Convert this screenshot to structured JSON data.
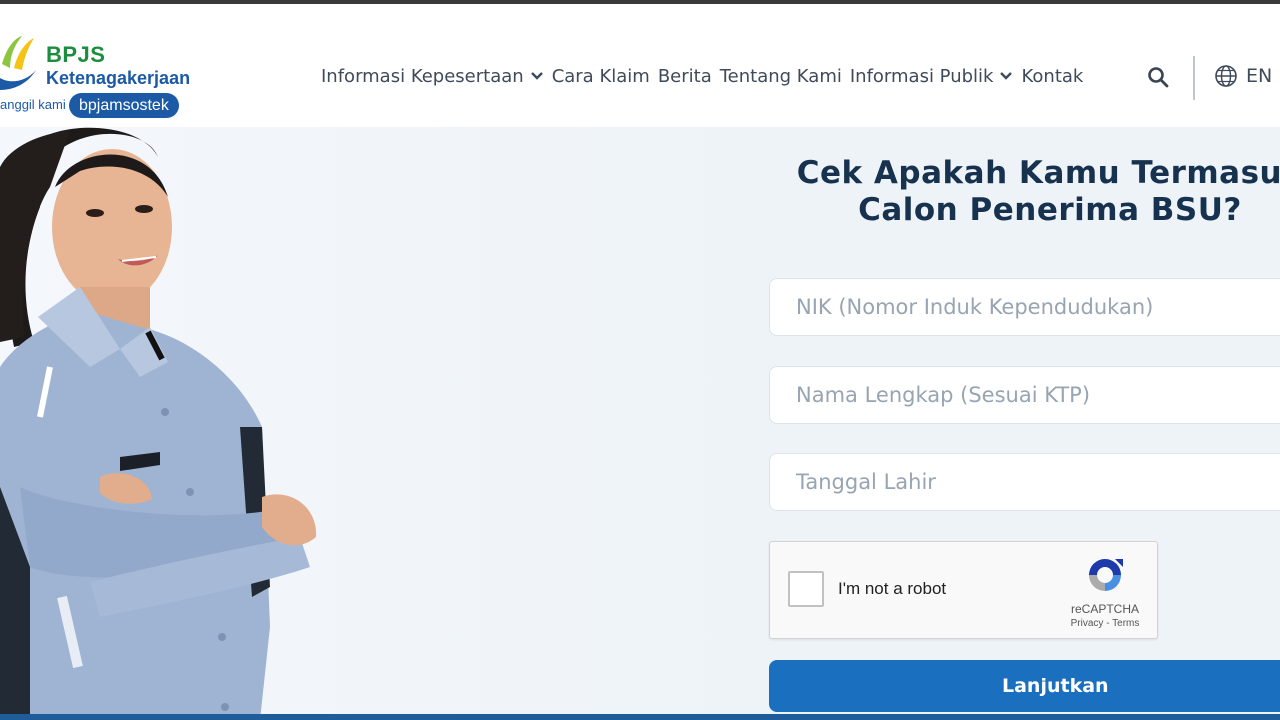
{
  "brand": {
    "name": "BPJS",
    "subtitle": "Ketenagakerjaan",
    "tagline": "anggil kami",
    "pill": "bpjamsostek",
    "colors": {
      "green": "#1b8e3e",
      "blue": "#1c5aa6"
    }
  },
  "nav": {
    "items": [
      {
        "label": "Informasi Kepesertaan",
        "has_dropdown": true
      },
      {
        "label": "Cara Klaim",
        "has_dropdown": false
      },
      {
        "label": "Berita",
        "has_dropdown": false
      },
      {
        "label": "Tentang Kami",
        "has_dropdown": false
      },
      {
        "label": "Informasi Publik",
        "has_dropdown": true
      },
      {
        "label": "Kontak",
        "has_dropdown": false
      }
    ],
    "search_icon": "search-icon",
    "language": {
      "icon": "globe-icon",
      "label": "EN"
    }
  },
  "form": {
    "title_line1": "Cek Apakah Kamu Termasuk",
    "title_line2": "Calon Penerima BSU?",
    "fields": [
      {
        "placeholder": "NIK (Nomor Induk Kependudukan)",
        "value": ""
      },
      {
        "placeholder": "Nama Lengkap (Sesuai KTP)",
        "value": ""
      },
      {
        "placeholder": "Tanggal Lahir",
        "value": ""
      }
    ],
    "captcha": {
      "label": "I'm not a robot",
      "brand": "reCAPTCHA",
      "links": "Privacy - Terms",
      "checked": false
    },
    "submit_label": "Lanjutkan",
    "accent_color": "#1a6fbf"
  }
}
